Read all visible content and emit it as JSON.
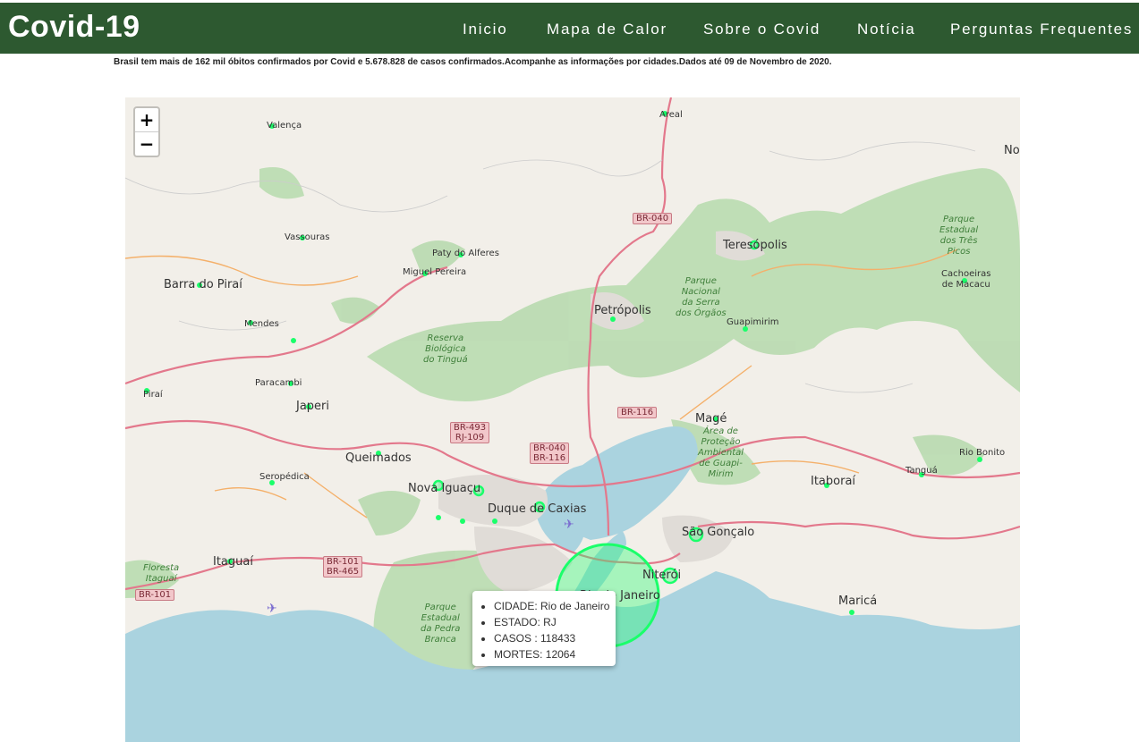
{
  "header": {
    "brand": "Covid-19",
    "nav": [
      "Inicio",
      "Mapa de Calor",
      "Sobre o Covid",
      "Notícia",
      "Perguntas Frequentes"
    ]
  },
  "subtitle": "Brasil tem mais de 162 mil óbitos confirmados por Covid e 5.678.828 de casos confirmados.Acompanhe as informações por cidades.Dados até 09 de Novembro de 2020.",
  "map": {
    "zoom_in": "+",
    "zoom_out": "−",
    "colors": {
      "marker": "#1aff6a",
      "header": "#2d5930",
      "water": "#aad3df"
    },
    "places": {
      "valenca": "Valença",
      "areal": "Areal",
      "vassouras": "Vassouras",
      "paty": "Paty do Alferes",
      "miguel": "Miguel Pereira",
      "barra": "Barra do Piraí",
      "mendes": "Mendes",
      "pirai": "Piraí",
      "paracambi": "Paracambi",
      "japeri": "Japeri",
      "queimados": "Queimados",
      "seropedica": "Seropédica",
      "novaiguacu": "Nova Iguaçu",
      "caxias": "Duque de Caxias",
      "petropolis": "Petrópolis",
      "teresopolis": "Teresópolis",
      "guapimirim": "Guapimirim",
      "mage": "Magé",
      "itaborai": "Itaboraí",
      "tangua": "Tanguá",
      "riobonito": "Rio Bonito",
      "cachoeiras": "Cachoeiras\nde Macacu",
      "saogoncalo": "São Gonçalo",
      "niteroi": "Niterói",
      "marica": "Maricá",
      "itaguai": "Itaguaí",
      "no": "No",
      "riojaneiro": "Rio de Janeiro"
    },
    "parks": {
      "tingua": "Reserva\nBiológica\ndo Tinguá",
      "orgaos": "Parque\nNacional\nda Serra\ndos Órgãos",
      "tres_picos": "Parque\nEstadual\ndos Três\nPicos",
      "guapi": "Área de\nProteção\nAmbiental\nde Guapi-\nMirim",
      "pedra": "Parque\nEstadual\nda Pedra\nBranca",
      "floresta": "Floresta\nItaguaí"
    },
    "roads": {
      "br040a": "BR-040",
      "br116a": "BR-116",
      "br493": "BR-493\nRJ-109",
      "br040b": "BR-040\nBR-116",
      "br101a": "BR-101\nBR-465",
      "br101b": "BR-101"
    },
    "popup": {
      "cidade": "CIDADE: Rio de Janeiro",
      "estado": "ESTADO: RJ",
      "casos": "CASOS : 118433",
      "mortes": "MORTES: 12064"
    },
    "markers": [
      {
        "city": "Rio de Janeiro",
        "casos": 118433,
        "mortes": 12064
      }
    ]
  }
}
